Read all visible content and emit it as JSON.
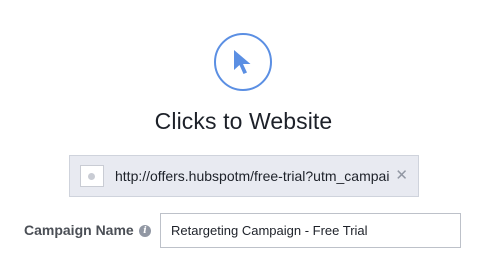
{
  "objective": {
    "icon": "cursor-arrow-icon",
    "title": "Clicks to Website"
  },
  "url_field": {
    "value": "http://offers.hubspotm/free-trial?utm_campaig",
    "thumbnail_icon": "image-placeholder-icon",
    "clear_icon_glyph": "✕"
  },
  "campaign": {
    "label": "Campaign Name",
    "info_icon_glyph": "i",
    "value": "Retargeting Campaign - Free Trial"
  },
  "colors": {
    "accent": "#5b8fe3",
    "url_bar_bg": "#e8eaf1",
    "text_primary": "#1d2129",
    "label_text": "#4b4f56",
    "icon_gray": "#9197a3"
  }
}
